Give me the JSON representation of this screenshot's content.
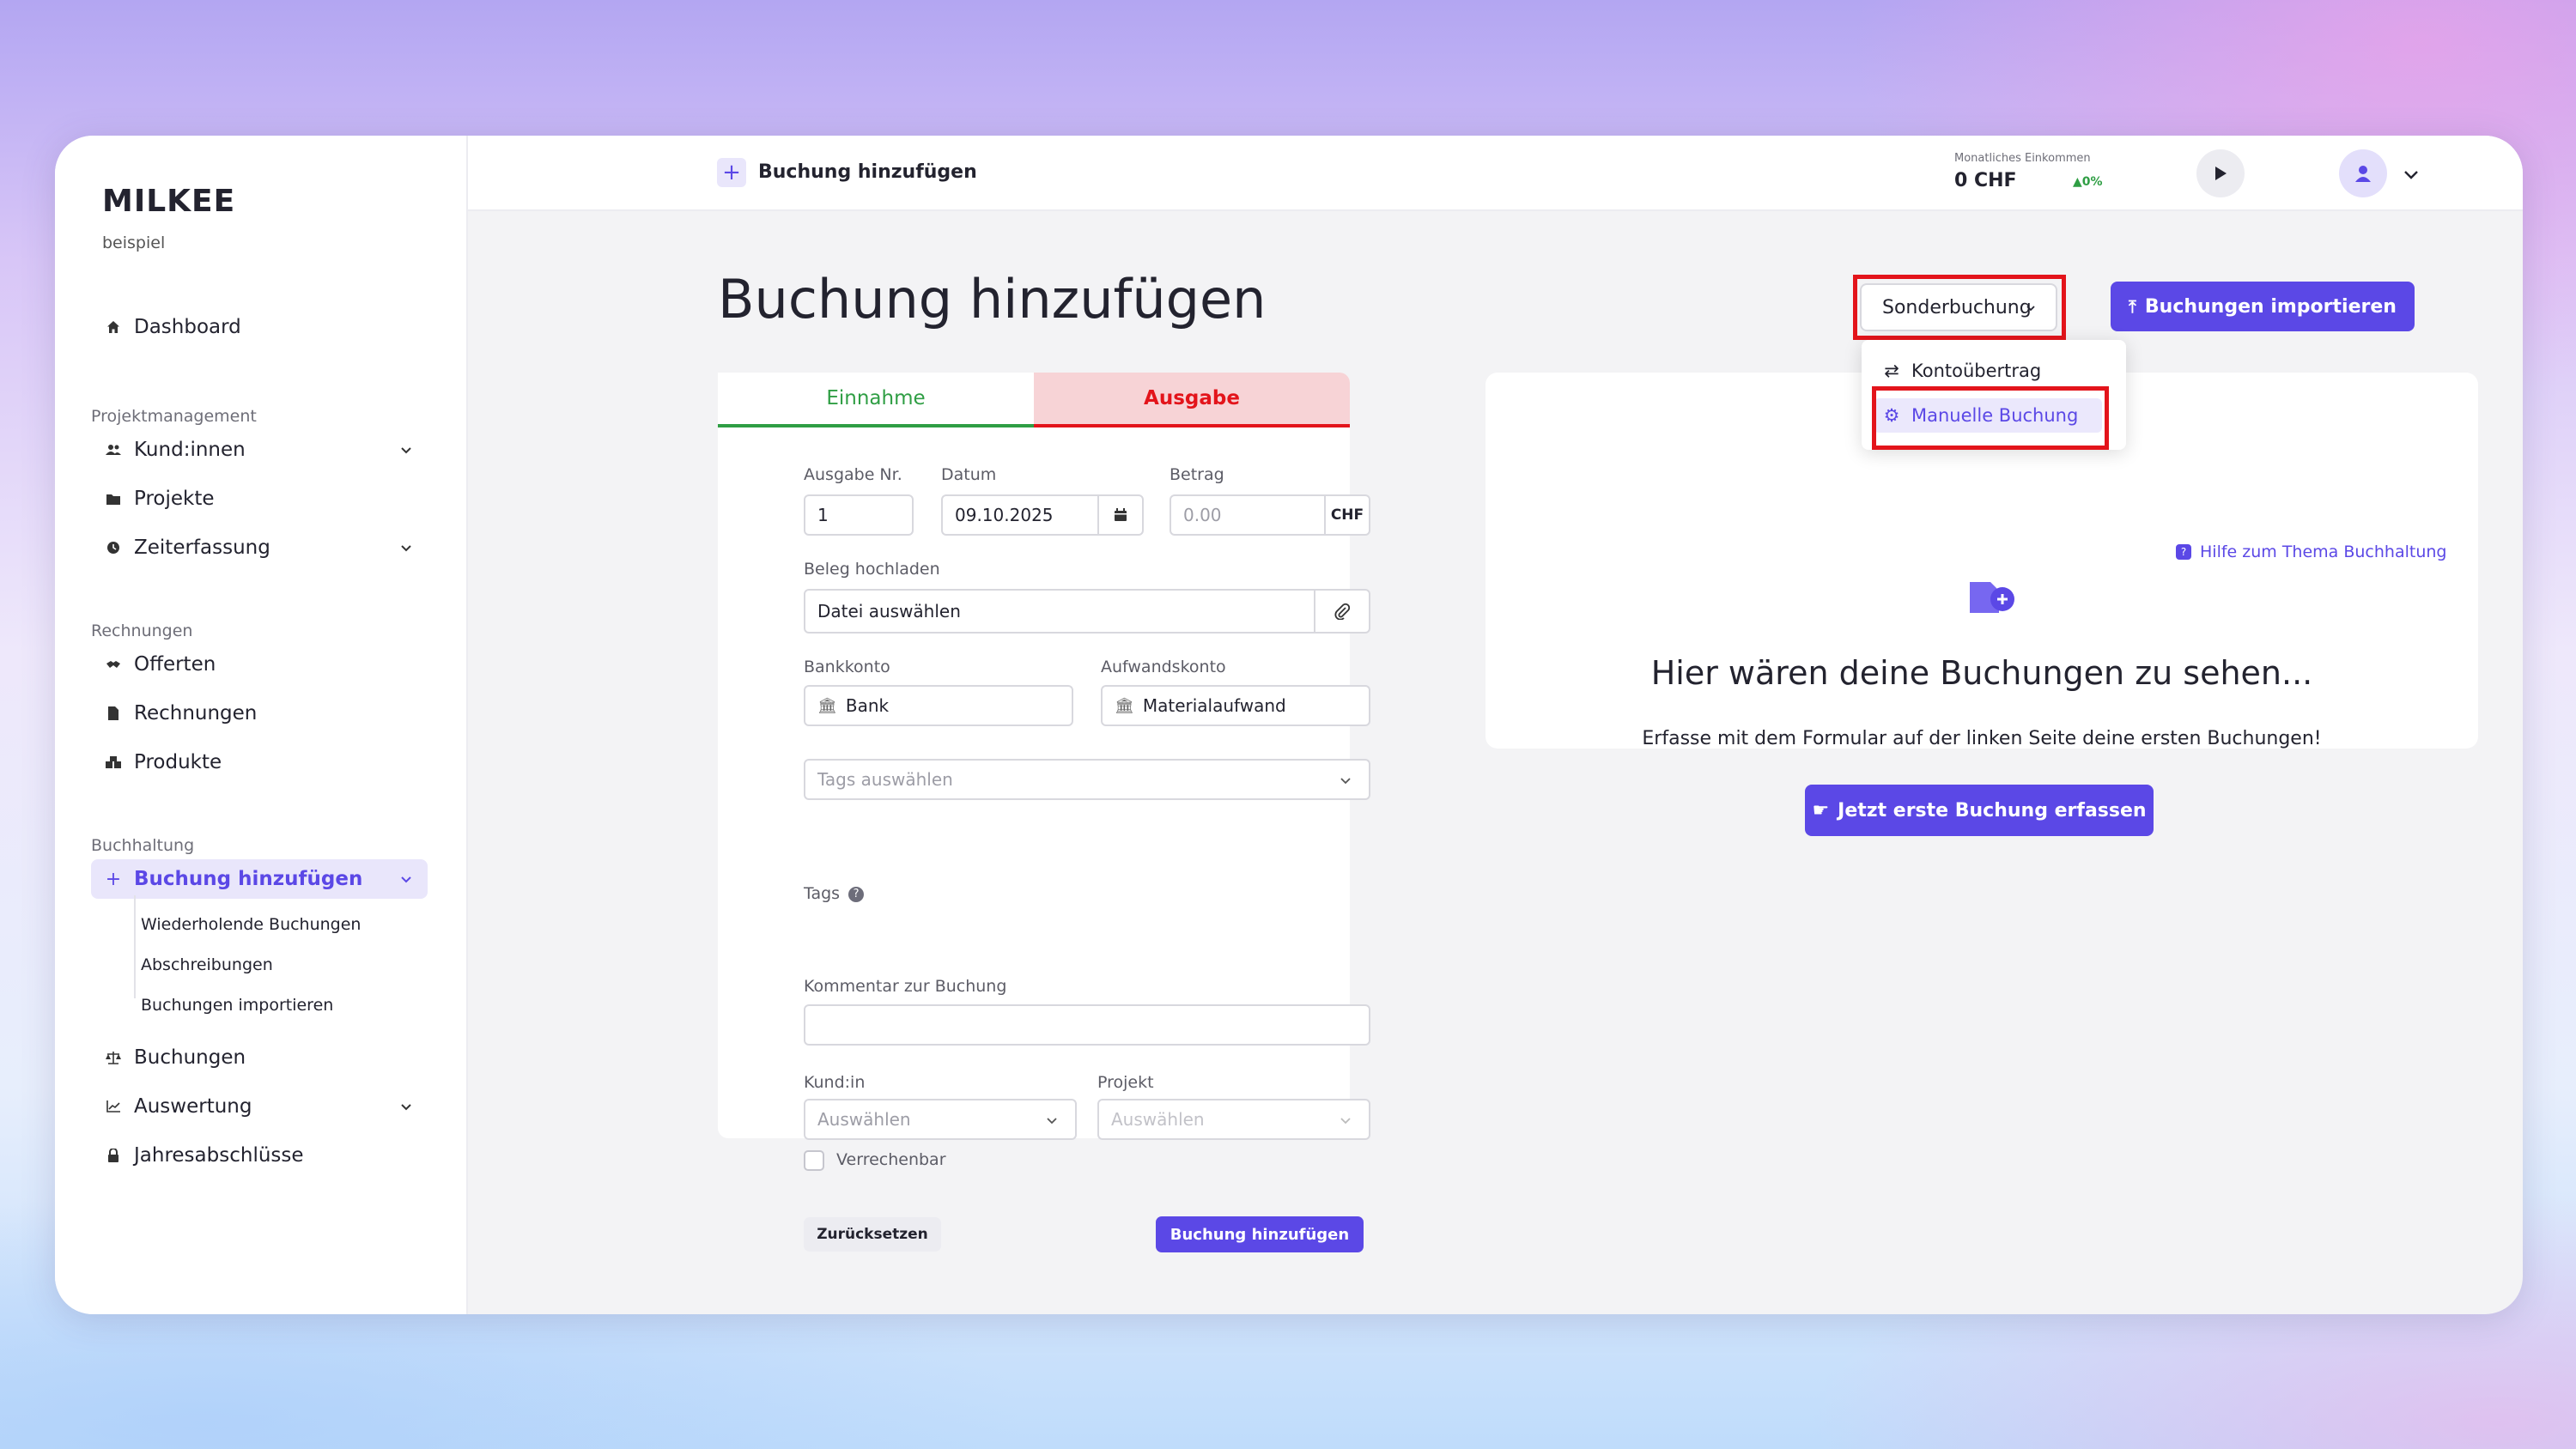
{
  "sidebar": {
    "brand": "MILKEE",
    "company": "beispiel",
    "dashboard": "Dashboard",
    "sections": {
      "projekt": "Projektmanagement",
      "rechnungen": "Rechnungen",
      "buchhaltung": "Buchhaltung"
    },
    "items": {
      "kunden": "Kund:innen",
      "projekte": "Projekte",
      "zeiterfassung": "Zeiterfassung",
      "offerten": "Offerten",
      "rechnungen": "Rechnungen",
      "produkte": "Produkte",
      "buchung_hinzufuegen": "Buchung hinzufügen",
      "buchungen": "Buchungen",
      "auswertung": "Auswertung",
      "jahresabschluesse": "Jahresabschlüsse"
    },
    "sub_items": {
      "wiederholende": "Wiederholende Buchungen",
      "abschreibungen": "Abschreibungen",
      "importieren": "Buchungen importieren"
    }
  },
  "topbar": {
    "title": "Buchung hinzufügen",
    "income_label": "Monatliches Einkommen",
    "income_value": "0 CHF",
    "income_delta": "0%"
  },
  "main": {
    "page_title": "Buchung hinzufügen",
    "sonderbuchung": "Sonderbuchung",
    "import_button": "Buchungen importieren",
    "dropdown": {
      "kontouebertrag": "Kontoübertrag",
      "manuelle": "Manuelle Buchung"
    }
  },
  "form": {
    "tab_einnahme": "Einnahme",
    "tab_ausgabe": "Ausgabe",
    "ausgabe_nr_label": "Ausgabe Nr.",
    "ausgabe_nr_value": "1",
    "datum_label": "Datum",
    "datum_value": "09.10.2025",
    "betrag_label": "Betrag",
    "betrag_placeholder": "0.00",
    "currency": "CHF",
    "beleg_label": "Beleg hochladen",
    "beleg_value": "Datei auswählen",
    "bankkonto_label": "Bankkonto",
    "bankkonto_value": "Bank",
    "aufwandskonto_label": "Aufwandskonto",
    "aufwandskonto_value": "Materialaufwand",
    "tags_label": "Tags",
    "tags_placeholder": "Tags auswählen",
    "kommentar_label": "Kommentar zur Buchung",
    "kunde_label": "Kund:in",
    "kunde_placeholder": "Auswählen",
    "projekt_label": "Projekt",
    "projekt_placeholder": "Auswählen",
    "verrechenbar": "Verrechenbar",
    "reset_button": "Zurücksetzen",
    "submit_button": "Buchung hinzufügen"
  },
  "empty_state": {
    "help_link": "Hilfe zum Thema Buchhaltung",
    "title": "Hier wären deine Buchungen zu sehen...",
    "text": "Erfasse mit dem Formular auf der linken Seite deine ersten Buchungen!",
    "button": "Jetzt erste Buchung erfassen"
  },
  "colors": {
    "accent": "#5b48e6",
    "income_green": "#2f9e44",
    "expense_red": "#e3141b",
    "highlight_box": "#e3141b"
  }
}
